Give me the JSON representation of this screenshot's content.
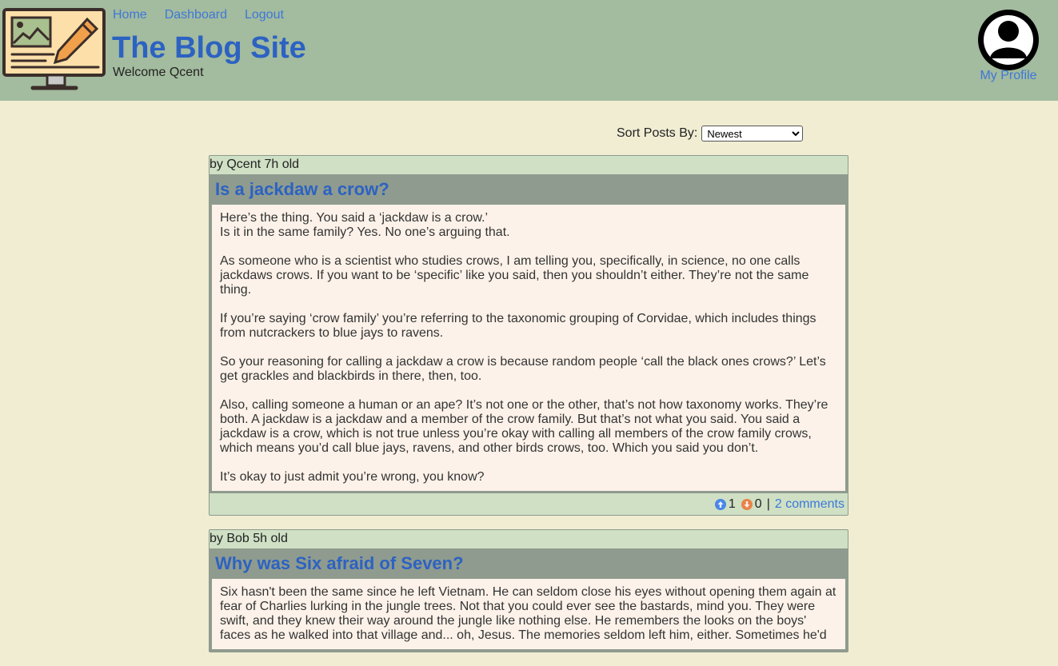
{
  "header": {
    "nav": [
      "Home",
      "Dashboard",
      "Logout"
    ],
    "site_title": "The Blog Site",
    "welcome": "Welcome Qcent",
    "profile_label": "My Profile"
  },
  "sort": {
    "label": "Sort Posts By:",
    "selected": "Newest"
  },
  "colors": {
    "header_bg": "#a3bb9e",
    "page_bg": "#f0edd3",
    "link": "#3d78d8",
    "title": "#2c62c2",
    "upvote": "#4a86e8",
    "downvote": "#e8834a"
  },
  "posts": [
    {
      "meta": "by Qcent 7h old",
      "title": "Is a jackdaw a crow?",
      "paragraphs": [
        "Here’s the thing. You said a ‘jackdaw is a crow.’\nIs it in the same family? Yes. No one’s arguing that.",
        "As someone who is a scientist who studies crows, I am telling you, specifically, in science, no one calls jackdaws crows. If you want to be ‘specific’ like you said, then you shouldn’t either. They’re not the same thing.",
        "If you’re saying ‘crow family’ you’re referring to the taxonomic grouping of Corvidae, which includes things from nutcrackers to blue jays to ravens.",
        "So your reasoning for calling a jackdaw a crow is because random people ‘call the black ones crows?’ Let’s get grackles and blackbirds in there, then, too.",
        "Also, calling someone a human or an ape? It’s not one or the other, that’s not how taxonomy works. They’re both. A jackdaw is a jackdaw and a member of the crow family. But that’s not what you said. You said a jackdaw is a crow, which is not true unless you’re okay with calling all members of the crow family crows, which means you’d call blue jays, ravens, and other birds crows, too. Which you said you don’t.",
        "It’s okay to just admit you’re wrong, you know?"
      ],
      "upvotes": "1",
      "downvotes": "0",
      "separator": "|",
      "comments": "2 comments"
    },
    {
      "meta": "by Bob 5h old",
      "title": "Why was Six afraid of Seven?",
      "paragraphs": [
        "Six hasn't been the same since he left Vietnam. He can seldom close his eyes without opening them again at fear of Charlies lurking in the jungle trees. Not that you could ever see the bastards, mind you. They were swift, and they knew their way around the jungle like nothing else. He remembers the looks on the boys' faces as he walked into that village and... oh, Jesus. The memories seldom left him, either. Sometimes he'd"
      ]
    }
  ]
}
